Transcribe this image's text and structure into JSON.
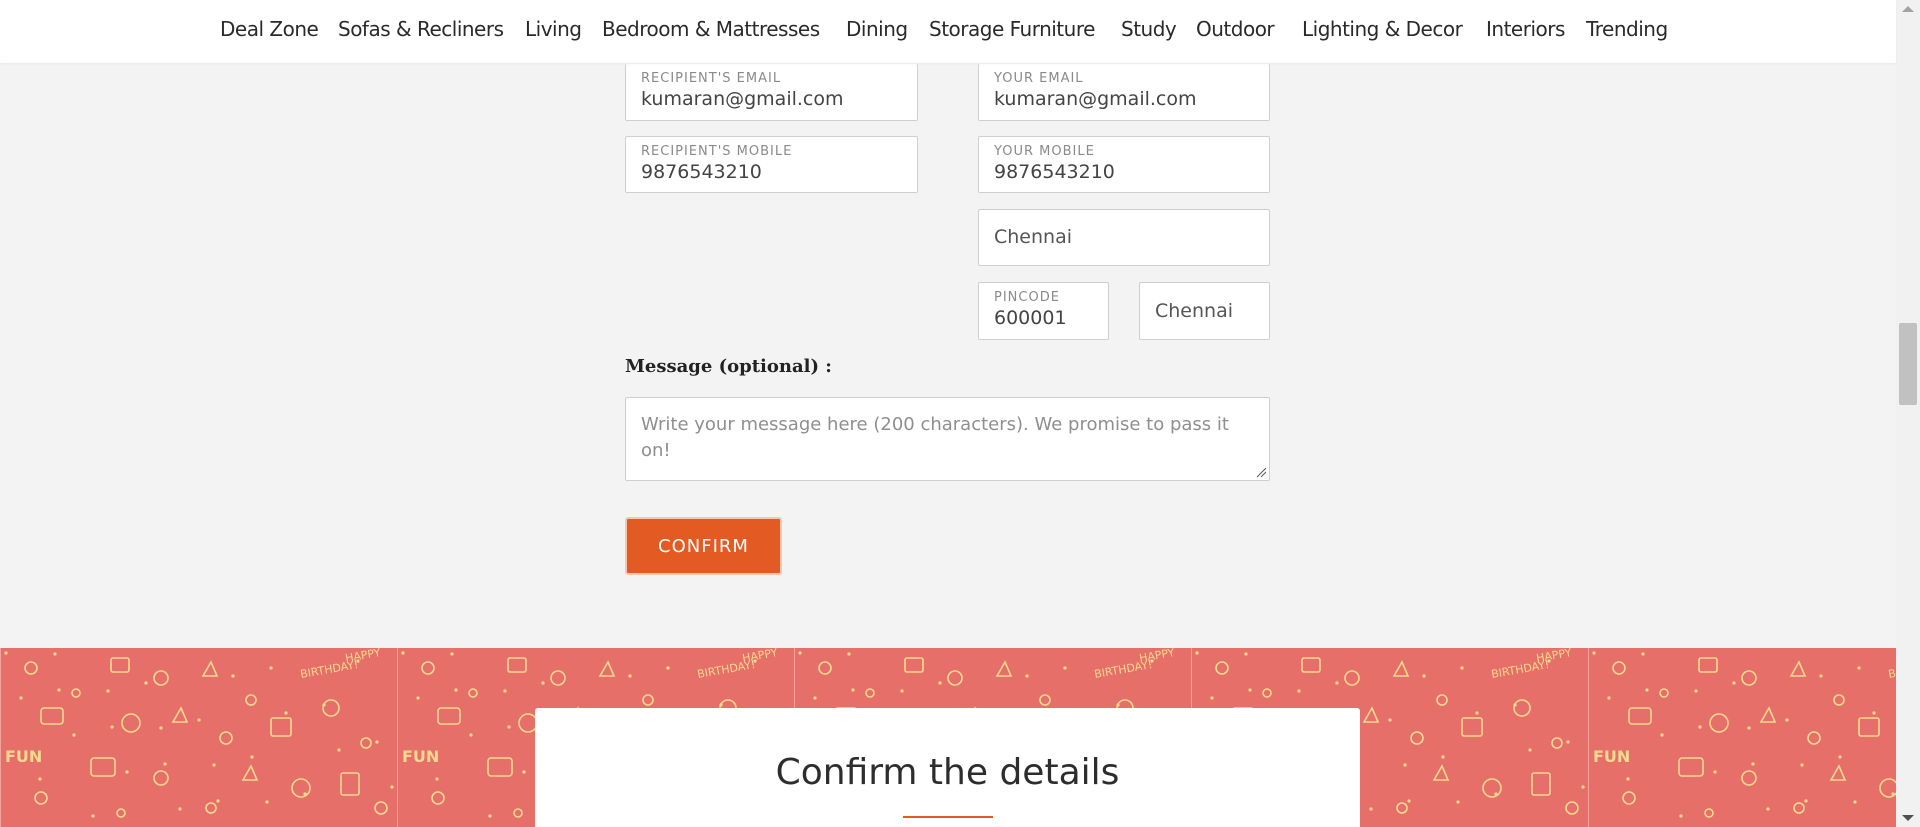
{
  "nav": {
    "items": [
      {
        "label": "Deal Zone"
      },
      {
        "label": "Sofas & Recliners"
      },
      {
        "label": "Living"
      },
      {
        "label": "Bedroom & Mattresses"
      },
      {
        "label": "Dining"
      },
      {
        "label": "Storage Furniture"
      },
      {
        "label": "Study"
      },
      {
        "label": "Outdoor"
      },
      {
        "label": "Lighting & Decor"
      },
      {
        "label": "Interiors"
      },
      {
        "label": "Trending"
      }
    ]
  },
  "form": {
    "recipient_email": {
      "label": "RECIPIENT'S EMAIL",
      "value": "kumaran@gmail.com"
    },
    "your_email": {
      "label": "YOUR EMAIL",
      "value": "kumaran@gmail.com"
    },
    "recipient_mobile": {
      "label": "RECIPIENT'S MOBILE",
      "value": "9876543210"
    },
    "your_mobile": {
      "label": "YOUR MOBILE",
      "value": "9876543210"
    },
    "city": {
      "value": "Chennai"
    },
    "pincode": {
      "label": "PINCODE",
      "value": "600001"
    },
    "state": {
      "value": "Chennai"
    },
    "message_label": "Message (optional) :",
    "message_placeholder": "Write your message here (200 characters). We promise to pass it on!",
    "confirm_label": "CONFIRM"
  },
  "banner": {
    "pattern_text_1": "HAPPY",
    "pattern_text_2": "BIRTHDAY!",
    "pattern_text_3": "FUN"
  },
  "confirm_section": {
    "title": "Confirm the details"
  },
  "colors": {
    "accent": "#e35a22",
    "banner_bg": "#e66f6a",
    "banner_doodle": "#f7d98f",
    "page_bg": "#f3f3f3"
  }
}
